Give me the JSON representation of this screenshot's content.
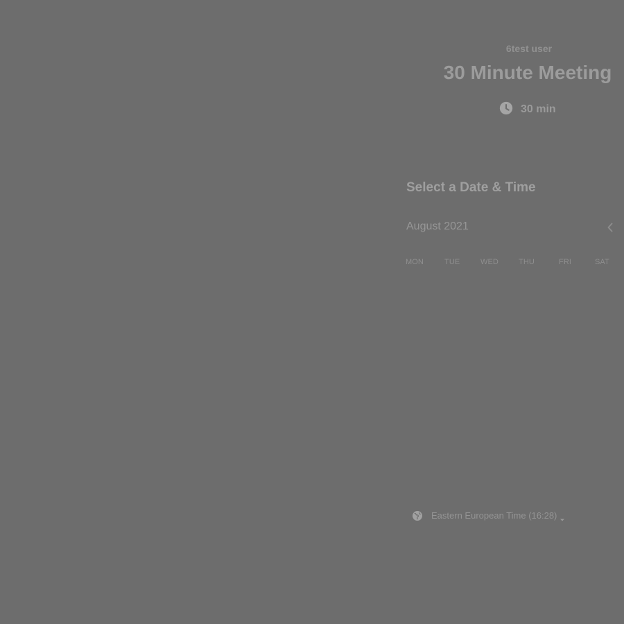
{
  "header": {
    "host_name": "6test user",
    "event_title": "30 Minute Meeting",
    "duration": "30 min",
    "duration_icon": "clock-icon"
  },
  "scheduler": {
    "section_title": "Select a Date & Time",
    "month_label": "August 2021",
    "prev_icon": "chevron-left-icon",
    "weekdays": [
      "MON",
      "TUE",
      "WED",
      "THU",
      "FRI",
      "SAT"
    ]
  },
  "timezone": {
    "label": "Eastern European Time (16:28)",
    "icon": "globe-icon",
    "dropdown_icon": "caret-down-icon"
  },
  "colors": {
    "overlay": "#6d6d6d",
    "text_muted": "#9a9a9a"
  }
}
